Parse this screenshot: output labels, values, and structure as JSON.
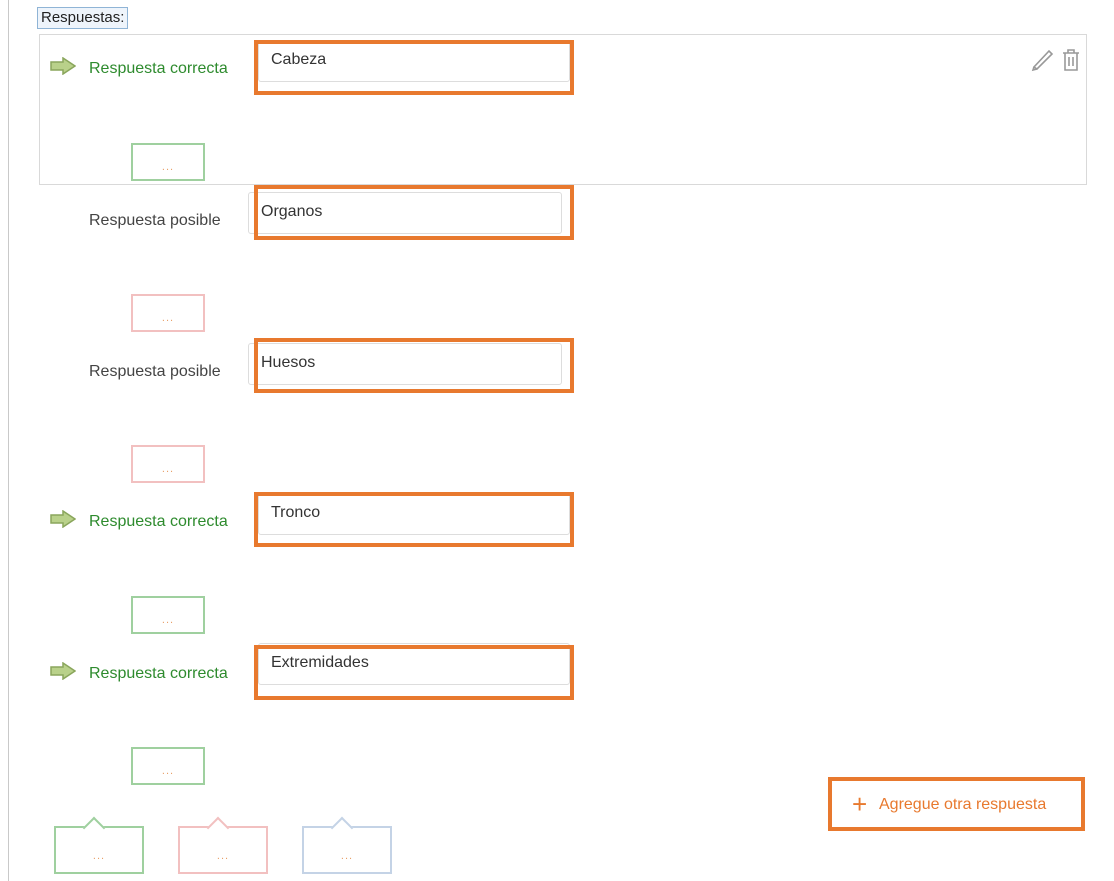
{
  "heading": "Respuestas:",
  "answers": [
    {
      "type": "correct",
      "label": "Respuesta correcta",
      "value": "Cabeza",
      "feedback_color": "green"
    },
    {
      "type": "possible",
      "label": "Respuesta posible",
      "value": "Organos",
      "feedback_color": "pink"
    },
    {
      "type": "possible",
      "label": "Respuesta posible",
      "value": "Huesos",
      "feedback_color": "pink"
    },
    {
      "type": "correct",
      "label": "Respuesta correcta",
      "value": "Tronco",
      "feedback_color": "green"
    },
    {
      "type": "correct",
      "label": "Respuesta correcta",
      "value": "Extremidades",
      "feedback_color": "green"
    }
  ],
  "feedback_dots": "...",
  "general_feedback": [
    {
      "color": "green",
      "dots": "..."
    },
    {
      "color": "pink",
      "dots": "..."
    },
    {
      "color": "blue",
      "dots": "..."
    }
  ],
  "add_answer": {
    "icon": "+",
    "label": "Agregue otra respuesta"
  },
  "icons": [
    "pencil-icon",
    "trash-icon"
  ],
  "colors": {
    "correct": "#2e8b2e",
    "highlight": "#e8792e",
    "green_border": "#9fd09f",
    "pink_border": "#f2c0c0",
    "blue_border": "#c4d3e6"
  }
}
